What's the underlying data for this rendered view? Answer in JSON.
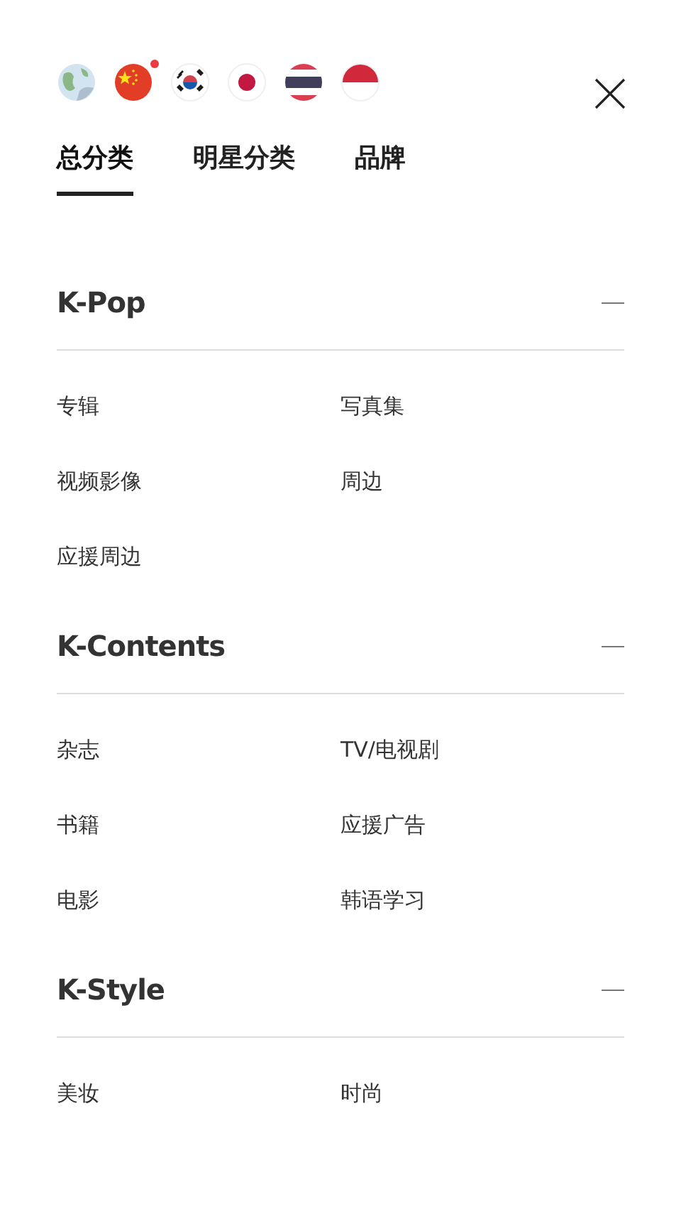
{
  "languages": [
    {
      "kind": "globe",
      "selected": false
    },
    {
      "kind": "china",
      "selected": true
    },
    {
      "kind": "korea",
      "selected": false
    },
    {
      "kind": "japan",
      "selected": false
    },
    {
      "kind": "thailand",
      "selected": false
    },
    {
      "kind": "indonesia",
      "selected": false
    }
  ],
  "tabs": [
    {
      "label": "总分类",
      "selected": true
    },
    {
      "label": "明星分类",
      "selected": false
    },
    {
      "label": "品牌",
      "selected": false
    }
  ],
  "sections": [
    {
      "title": "K-Pop",
      "expanded": true,
      "items": [
        "专辑",
        "写真集",
        "视频影像",
        "周边",
        "应援周边"
      ]
    },
    {
      "title": "K-Contents",
      "expanded": true,
      "items": [
        "杂志",
        "TV/电视剧",
        "书籍",
        "应援广告",
        "电影",
        "韩语学习"
      ]
    },
    {
      "title": "K-Style",
      "expanded": true,
      "items": [
        "美妆",
        "时尚"
      ]
    }
  ]
}
